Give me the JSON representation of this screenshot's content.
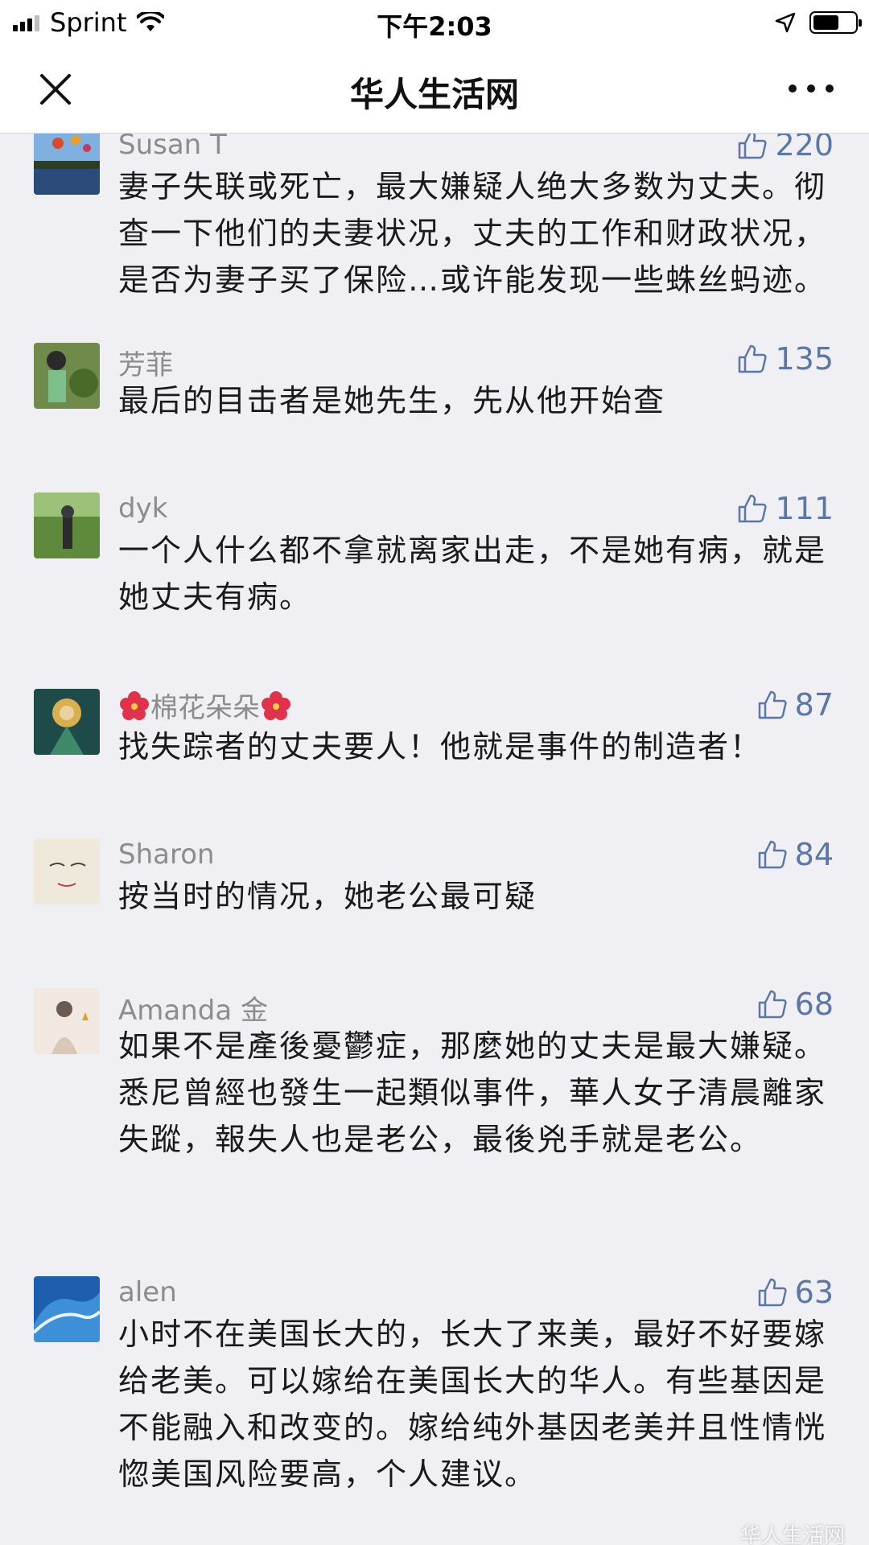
{
  "status_bar": {
    "carrier": "Sprint",
    "time": "下午2:03"
  },
  "nav": {
    "title": "华人生活网"
  },
  "comments": [
    {
      "name": "Susan T",
      "likes": "220",
      "text": "妻子失联或死亡，最大嫌疑人绝大多数为丈夫。彻查一下他们的夫妻状况，丈夫的工作和财政状况，是否为妻子买了保险…或许能发现一些蛛丝蚂迹。"
    },
    {
      "name": "芳菲",
      "likes": "135",
      "text": "最后的目击者是她先生，先从他开始查"
    },
    {
      "name": "dyk",
      "likes": "111",
      "text": "一个人什么都不拿就离家出走，不是她有病，就是她丈夫有病。"
    },
    {
      "name": "棉花朵朵",
      "likes": "87",
      "text": "找失踪者的丈夫要人！他就是事件的制造者！"
    },
    {
      "name": "Sharon",
      "likes": "84",
      "text": "按当时的情况，她老公最可疑"
    },
    {
      "name": "Amanda 金",
      "likes": "68",
      "text": "如果不是產後憂鬱症，那麼她的丈夫是最大嫌疑。悉尼曾經也發生一起類似事件，華人女子清晨離家失蹤，報失人也是老公，最後兇手就是老公。"
    },
    {
      "name": "alen",
      "likes": "63",
      "text": "小时不在美国长大的，长大了来美，最好不好要嫁给老美。可以嫁给在美国长大的华人。有些基因是不能融入和改变的。嫁给纯外基因老美并且性情恍惚美国风险要高，个人建议。"
    }
  ],
  "watermark": "华人生活网",
  "icons": {
    "like": "thumbs-up-icon",
    "close": "close-icon",
    "more": "more-dots-icon"
  },
  "colors": {
    "like_blue": "#5a77a6",
    "name_gray": "#8c8c8c",
    "background": "#efeff4"
  }
}
